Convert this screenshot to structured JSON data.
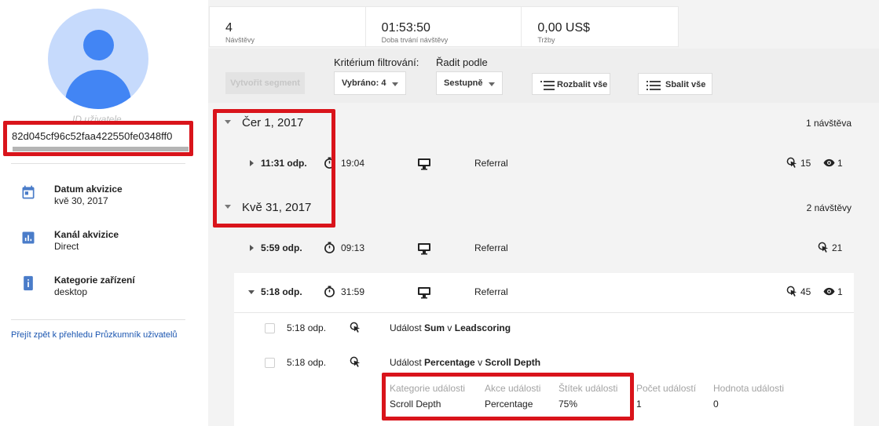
{
  "user": {
    "id_label": "ID uživatele",
    "id_value": "82d045cf96c52faa422550fe0348ff0"
  },
  "sidebar": {
    "items": [
      {
        "label": "Datum akvizice",
        "value": "kvě 30, 2017",
        "icon": "calendar-icon"
      },
      {
        "label": "Kanál akvizice",
        "value": "Direct",
        "icon": "bar-chart-icon"
      },
      {
        "label": "Kategorie zařízení",
        "value": "desktop",
        "icon": "device-info-icon"
      }
    ],
    "back_link": "Přejít zpět k přehledu Průzkumník uživatelů"
  },
  "metrics": [
    {
      "value": "4",
      "label": "Návštěvy"
    },
    {
      "value": "01:53:50",
      "label": "Doba trvání návštěvy"
    },
    {
      "value": "0,00 US$",
      "label": "Tržby"
    }
  ],
  "filters": {
    "create_segment": "Vytvořit segment",
    "filter_label": "Kritérium filtrování:",
    "filter_value": "Vybráno: 4",
    "sort_label": "Řadit podle",
    "sort_value": "Sestupně",
    "expand_all": "Rozbalit vše",
    "collapse_all": "Sbalit vše"
  },
  "days": [
    {
      "date": "Čer 1, 2017",
      "count": "1 návštěva",
      "sessions": [
        {
          "time": "11:31 odp.",
          "duration": "19:04",
          "channel": "Referral",
          "events": "15",
          "views": "1",
          "expanded": false
        }
      ]
    },
    {
      "date": "Kvě 31, 2017",
      "count": "2 návštěvy",
      "sessions": [
        {
          "time": "5:59 odp.",
          "duration": "09:13",
          "channel": "Referral",
          "events": "21",
          "views": "",
          "expanded": false
        },
        {
          "time": "5:18 odp.",
          "duration": "31:59",
          "channel": "Referral",
          "events": "45",
          "views": "1",
          "expanded": true
        }
      ]
    }
  ],
  "events": [
    {
      "time": "5:18 odp.",
      "prefix": "Událost",
      "action": "Sum",
      "joiner": "v",
      "category": "Leadscoring"
    },
    {
      "time": "5:18 odp.",
      "prefix": "Událost",
      "action": "Percentage",
      "joiner": "v",
      "category": "Scroll Depth"
    }
  ],
  "event_details": {
    "headers": [
      "Kategorie události",
      "Akce události",
      "Štítek události",
      "Počet událostí",
      "Hodnota události"
    ],
    "values": [
      "Scroll Depth",
      "Percentage",
      "75%",
      "1",
      "0"
    ]
  },
  "colors": {
    "highlight": "#d9141b",
    "avatar_bg": "#c6dafc",
    "avatar_fg": "#4285f4",
    "icon_blue": "#4a7cc9",
    "link": "#1a55b0"
  }
}
